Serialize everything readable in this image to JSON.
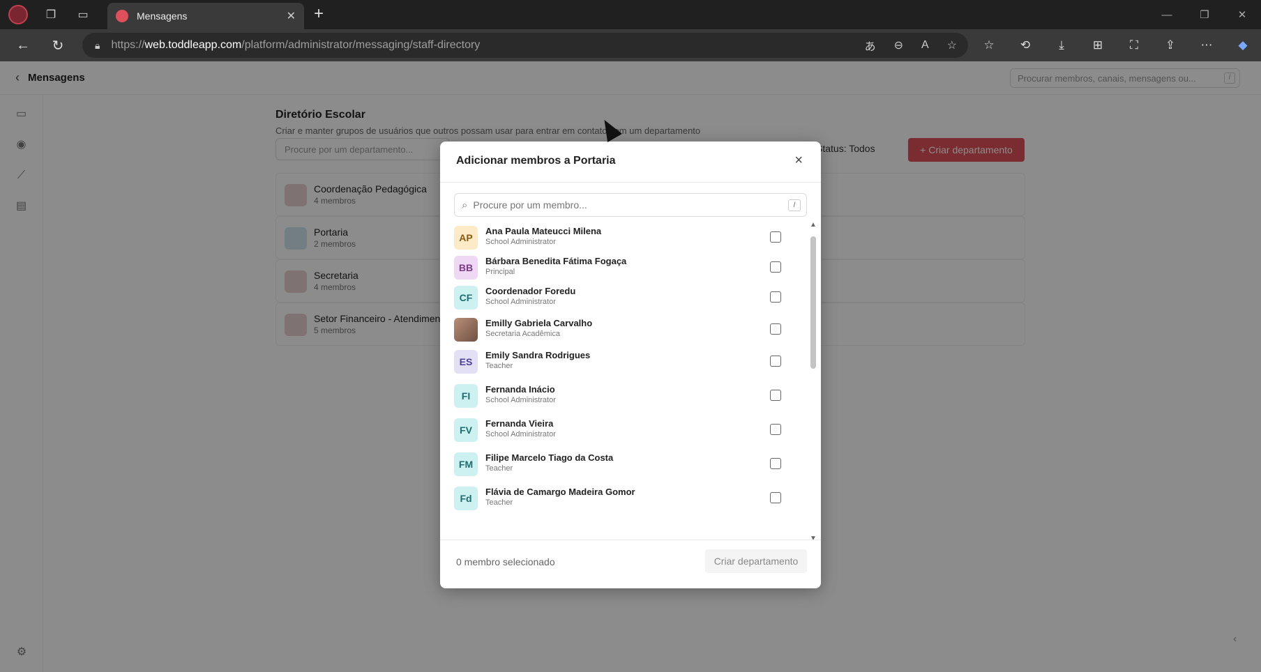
{
  "browser": {
    "tab_title": "Mensagens",
    "tab_close": "✕",
    "new_tab": "+",
    "url_host": "web.toddleapp.com",
    "url_scheme": "https://",
    "url_path": "/platform/administrator/messaging/staff-directory"
  },
  "app": {
    "header_title": "Mensagens",
    "global_search_placeholder": "Procurar membros, canais, mensagens ou...",
    "global_search_kbd": "/",
    "directory_title": "Diretório Escolar",
    "directory_subtitle": "Criar e manter grupos de usuários que outros possam usar para entrar em contato com um departamento",
    "department_search_placeholder": "Procure por um departamento...",
    "status_filter": "Status: Todos",
    "create_department_button": "+ Criar departamento",
    "departments": [
      {
        "name": "Coordenação Pedagógica",
        "count": "4 membros"
      },
      {
        "name": "Portaria",
        "count": "2 membros"
      },
      {
        "name": "Secretaria",
        "count": "4 membros"
      },
      {
        "name": "Setor Financeiro - Atendiment",
        "count": "5 membros"
      }
    ]
  },
  "modal": {
    "title": "Adicionar membros a Portaria",
    "close": "×",
    "search_placeholder": "Procure por um membro...",
    "search_kbd": "/",
    "members": [
      {
        "initials": "AP",
        "name": "Ana Paula Mateucci Milena",
        "role": "School Administrator",
        "bg": "#fdebc8",
        "fg": "#8a5a10"
      },
      {
        "initials": "BB",
        "name": "Bárbara Benedita Fátima Fogaça",
        "role": "Principal",
        "bg": "#eed8f3",
        "fg": "#7a3a8a"
      },
      {
        "initials": "CF",
        "name": "Coordenador Foredu",
        "role": "School Administrator",
        "bg": "#cdf1f1",
        "fg": "#1e6e6e"
      },
      {
        "initials": "",
        "name": "Emilly Gabriela Carvalho",
        "role": "Secretaria Acadêmica",
        "bg": "",
        "fg": ""
      },
      {
        "initials": "ES",
        "name": "Emily Sandra Rodrigues",
        "role": "Teacher",
        "bg": "#e3e0f5",
        "fg": "#4a3e9a"
      },
      {
        "initials": "FI",
        "name": "Fernanda Inácio",
        "role": "School Administrator",
        "bg": "#cdf1f1",
        "fg": "#1e6e6e"
      },
      {
        "initials": "FV",
        "name": "Fernanda Vieira",
        "role": "School Administrator",
        "bg": "#cdf1f1",
        "fg": "#1e6e6e"
      },
      {
        "initials": "FM",
        "name": "Filipe Marcelo Tiago da Costa",
        "role": "Teacher",
        "bg": "#cdf1f1",
        "fg": "#1e6e6e"
      },
      {
        "initials": "Fd",
        "name": "Flávia de Camargo Madeira Gomor",
        "role": "Teacher",
        "bg": "#cdf1f1",
        "fg": "#1e6e6e"
      }
    ],
    "selected_count": "0 membro selecionado",
    "create_button": "Criar departamento"
  }
}
